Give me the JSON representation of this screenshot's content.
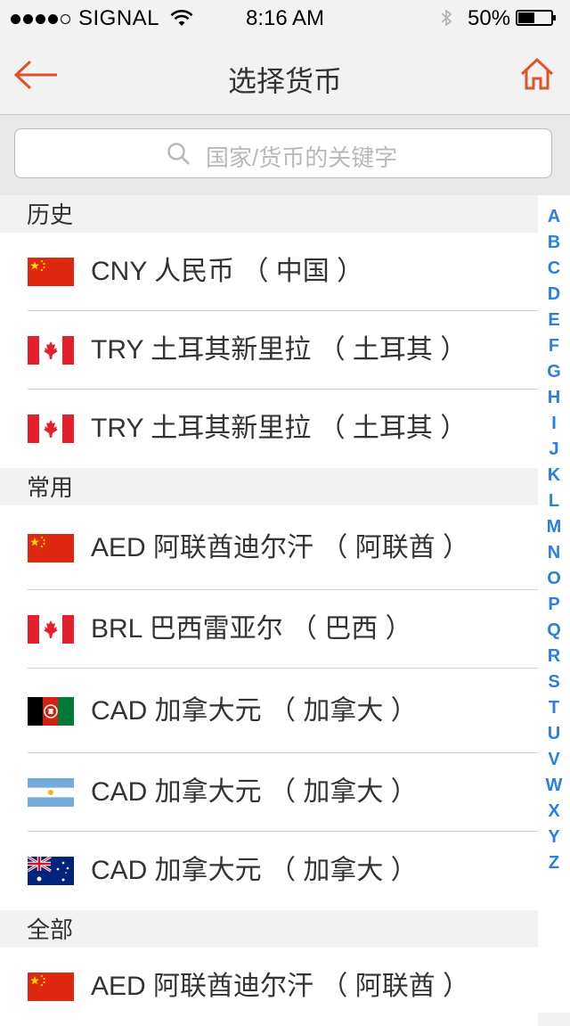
{
  "status_bar": {
    "carrier": "SIGNAL",
    "time": "8:16 AM",
    "battery": "50%",
    "battery_level": 0.5,
    "signal_bars": 4
  },
  "nav": {
    "title": "选择货币",
    "back_icon": "arrow-left-icon",
    "home_icon": "home-icon",
    "accent_color": "#e0522a"
  },
  "search": {
    "placeholder": "国家/货币的关键字"
  },
  "sections": [
    {
      "title": "历史",
      "items": [
        {
          "label": "CNY 人民币 （ 中国 ）",
          "flag": "flag-china"
        },
        {
          "label": "TRY 土耳其新里拉 （ 土耳其 ）",
          "flag": "flag-canada"
        },
        {
          "label": "TRY 土耳其新里拉 （ 土耳其 ）",
          "flag": "flag-canada"
        }
      ]
    },
    {
      "title": "常用",
      "items": [
        {
          "label": "AED 阿联酋迪尔汗 （ 阿联酋 ）",
          "flag": "flag-china"
        },
        {
          "label": "BRL 巴西雷亚尔 （ 巴西 ）",
          "flag": "flag-canada"
        },
        {
          "label": "CAD 加拿大元 （ 加拿大 ）",
          "flag": "flag-afghanistan"
        },
        {
          "label": "CAD 加拿大元 （ 加拿大 ）",
          "flag": "flag-argentina"
        },
        {
          "label": "CAD 加拿大元 （ 加拿大 ）",
          "flag": "flag-australia"
        }
      ]
    },
    {
      "title": "全部",
      "items": [
        {
          "label": "AED 阿联酋迪尔汗 （ 阿联酋 ）",
          "flag": "flag-china"
        }
      ]
    }
  ],
  "index_letters": [
    "A",
    "B",
    "C",
    "D",
    "E",
    "F",
    "G",
    "H",
    "I",
    "J",
    "K",
    "L",
    "M",
    "N",
    "O",
    "P",
    "Q",
    "R",
    "S",
    "T",
    "U",
    "V",
    "W",
    "X",
    "Y",
    "Z"
  ],
  "colors": {
    "index_letter": "#2a7fe0"
  }
}
